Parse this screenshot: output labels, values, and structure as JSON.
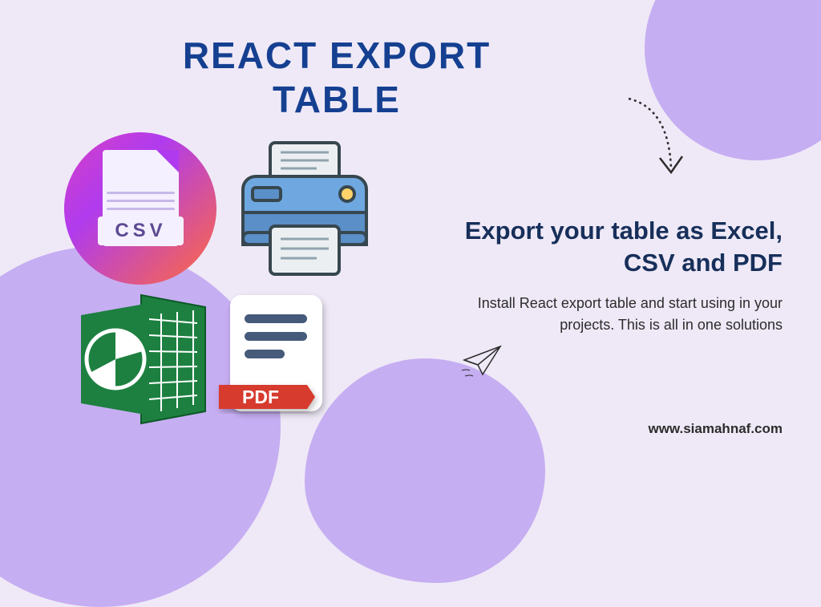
{
  "title": "REACT EXPORT TABLE",
  "subtitle": "Export your table as Excel, CSV and  PDF",
  "description": "Install React export table and start using in your projects. This is all in one solutions",
  "website": "www.siamahnaf.com",
  "csv_label": "CSV",
  "pdf_label": "PDF"
}
